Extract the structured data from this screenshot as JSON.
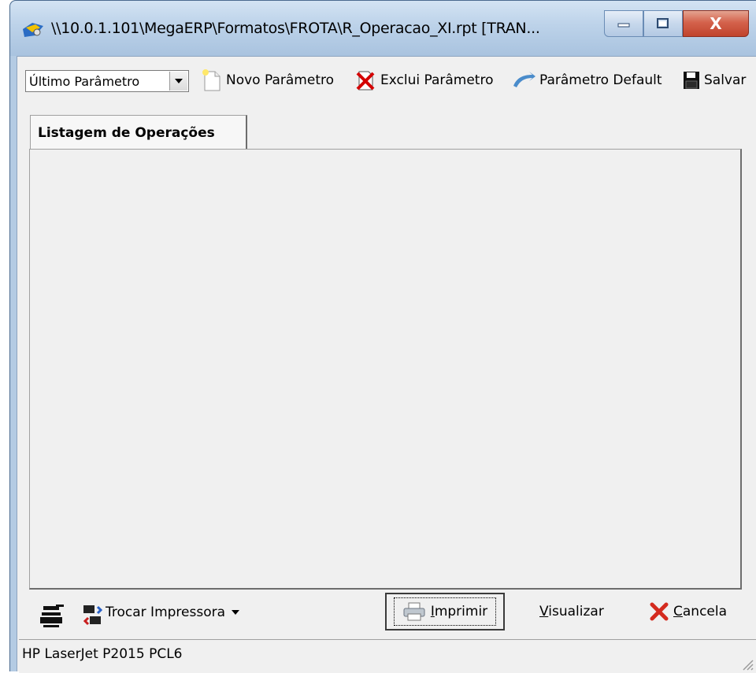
{
  "window": {
    "title": "\\\\10.0.1.101\\MegaERP\\Formatos\\FROTA\\R_Operacao_XI.rpt [TRAN...",
    "icon": "app-icon",
    "controls": [
      "minimize-icon",
      "maximize-icon",
      "close-icon"
    ],
    "close_label": "X"
  },
  "toolbar": {
    "param_select_value": "Último Parâmetro",
    "novo_label": "Novo Parâmetro",
    "exclui_label": "Exclui Parâmetro",
    "default_label": "Parâmetro Default",
    "salvar_label": "Salvar"
  },
  "tabs": [
    {
      "label": "Listagem de Operações",
      "selected": true
    }
  ],
  "footer": {
    "trocar_label": "Trocar Impressora",
    "imprimir_label": "mprimir",
    "imprimir_accel": "I",
    "visualizar_label": "isualizar",
    "visualizar_accel": "V",
    "cancela_label": "ancela",
    "cancela_accel": "C"
  },
  "status": {
    "printer": "HP LaserJet P2015 PCL6"
  },
  "colors": {
    "close_red": "#c0432c",
    "frame_blue": "#b4cbe3",
    "face": "#f0f0f0"
  }
}
